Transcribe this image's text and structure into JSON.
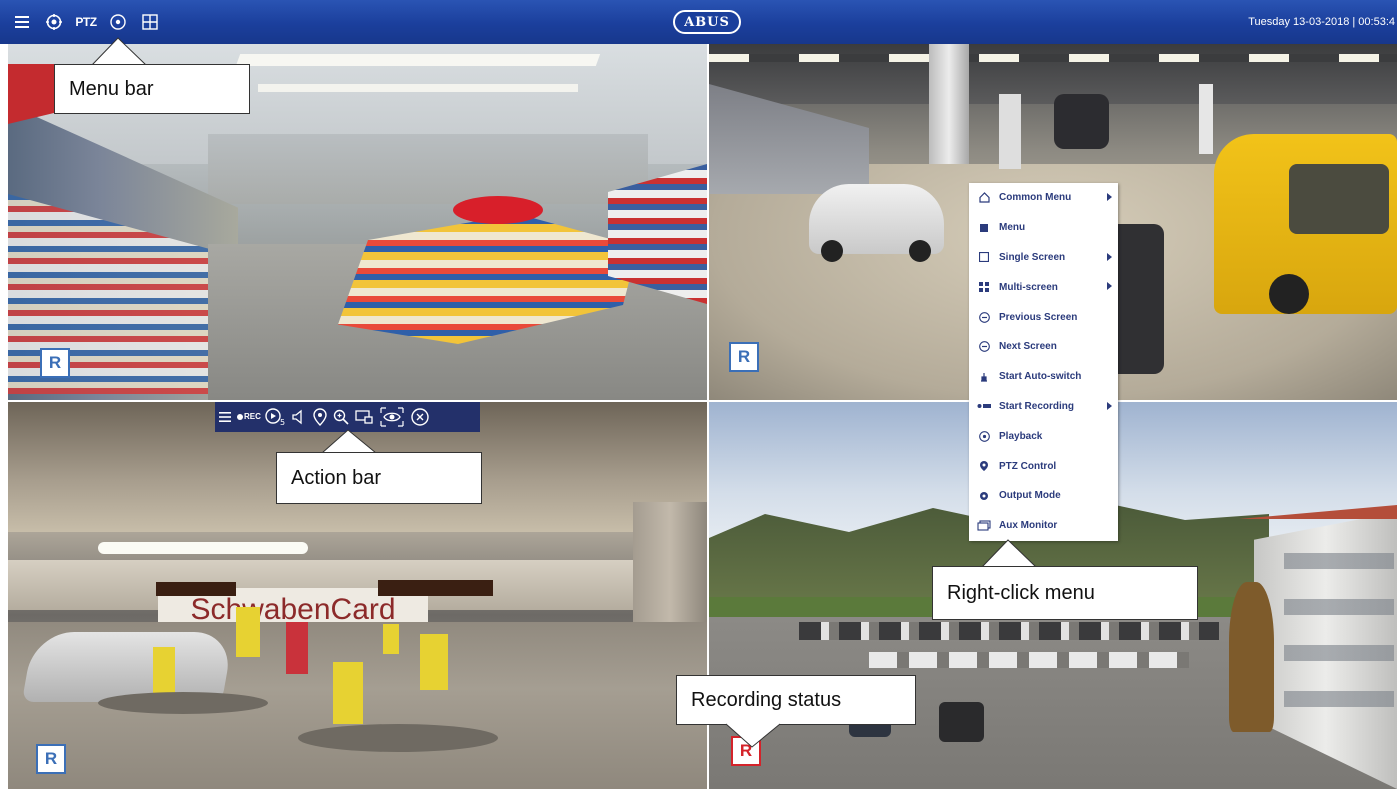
{
  "menu_bar": {
    "icons": [
      "menu-icon",
      "settings-icon",
      "ptz-icon",
      "playback-icon",
      "layout-icon"
    ],
    "ptz_label": "PTZ",
    "logo": "ABUS",
    "datetime": "Tuesday 13-03-2018 | 00:53:4"
  },
  "cameras": [
    {
      "id": "cam1",
      "scene": "supermarket",
      "recording_status": "R",
      "recording_active": false
    },
    {
      "id": "cam2",
      "scene": "petrol-station",
      "recording_status": "R",
      "recording_active": false
    },
    {
      "id": "cam3",
      "scene": "parking-garage",
      "recording_status": "R",
      "recording_active": false,
      "sign_text": "SchwabenCard"
    },
    {
      "id": "cam4",
      "scene": "outdoor-parking",
      "recording_status": "R",
      "recording_active": true
    }
  ],
  "action_bar": {
    "rec_label": "REC",
    "icons": [
      "menu-icon",
      "record-icon",
      "playback-icon",
      "audio-icon",
      "location-icon",
      "zoom-icon",
      "screen-icon",
      "eye-icon",
      "close-icon"
    ]
  },
  "context_menu": {
    "items": [
      {
        "label": "Common Menu",
        "icon": "home-icon",
        "submenu": true
      },
      {
        "label": "Menu",
        "icon": "menu-icon",
        "submenu": false
      },
      {
        "label": "Single Screen",
        "icon": "single-screen-icon",
        "submenu": true
      },
      {
        "label": "Multi-screen",
        "icon": "multi-screen-icon",
        "submenu": true
      },
      {
        "label": "Previous Screen",
        "icon": "previous-icon",
        "submenu": false
      },
      {
        "label": "Next Screen",
        "icon": "next-icon",
        "submenu": false
      },
      {
        "label": "Start Auto-switch",
        "icon": "auto-switch-icon",
        "submenu": false
      },
      {
        "label": "Start Recording",
        "icon": "record-icon",
        "submenu": true
      },
      {
        "label": "Playback",
        "icon": "playback-icon",
        "submenu": false
      },
      {
        "label": "PTZ Control",
        "icon": "ptz-icon",
        "submenu": false
      },
      {
        "label": "Output Mode",
        "icon": "output-mode-icon",
        "submenu": false
      },
      {
        "label": "Aux Monitor",
        "icon": "aux-monitor-icon",
        "submenu": false
      }
    ]
  },
  "callouts": {
    "menu_bar": "Menu bar",
    "action_bar": "Action bar",
    "right_click_menu": "Right-click menu",
    "recording_status": "Recording status"
  },
  "colors": {
    "menu_bar_bg": "#1b3f9c",
    "action_bar_bg": "#23306a",
    "badge_inactive": "#3b6fb7",
    "badge_active": "#d4232a",
    "menu_text": "#2b3b7c"
  }
}
